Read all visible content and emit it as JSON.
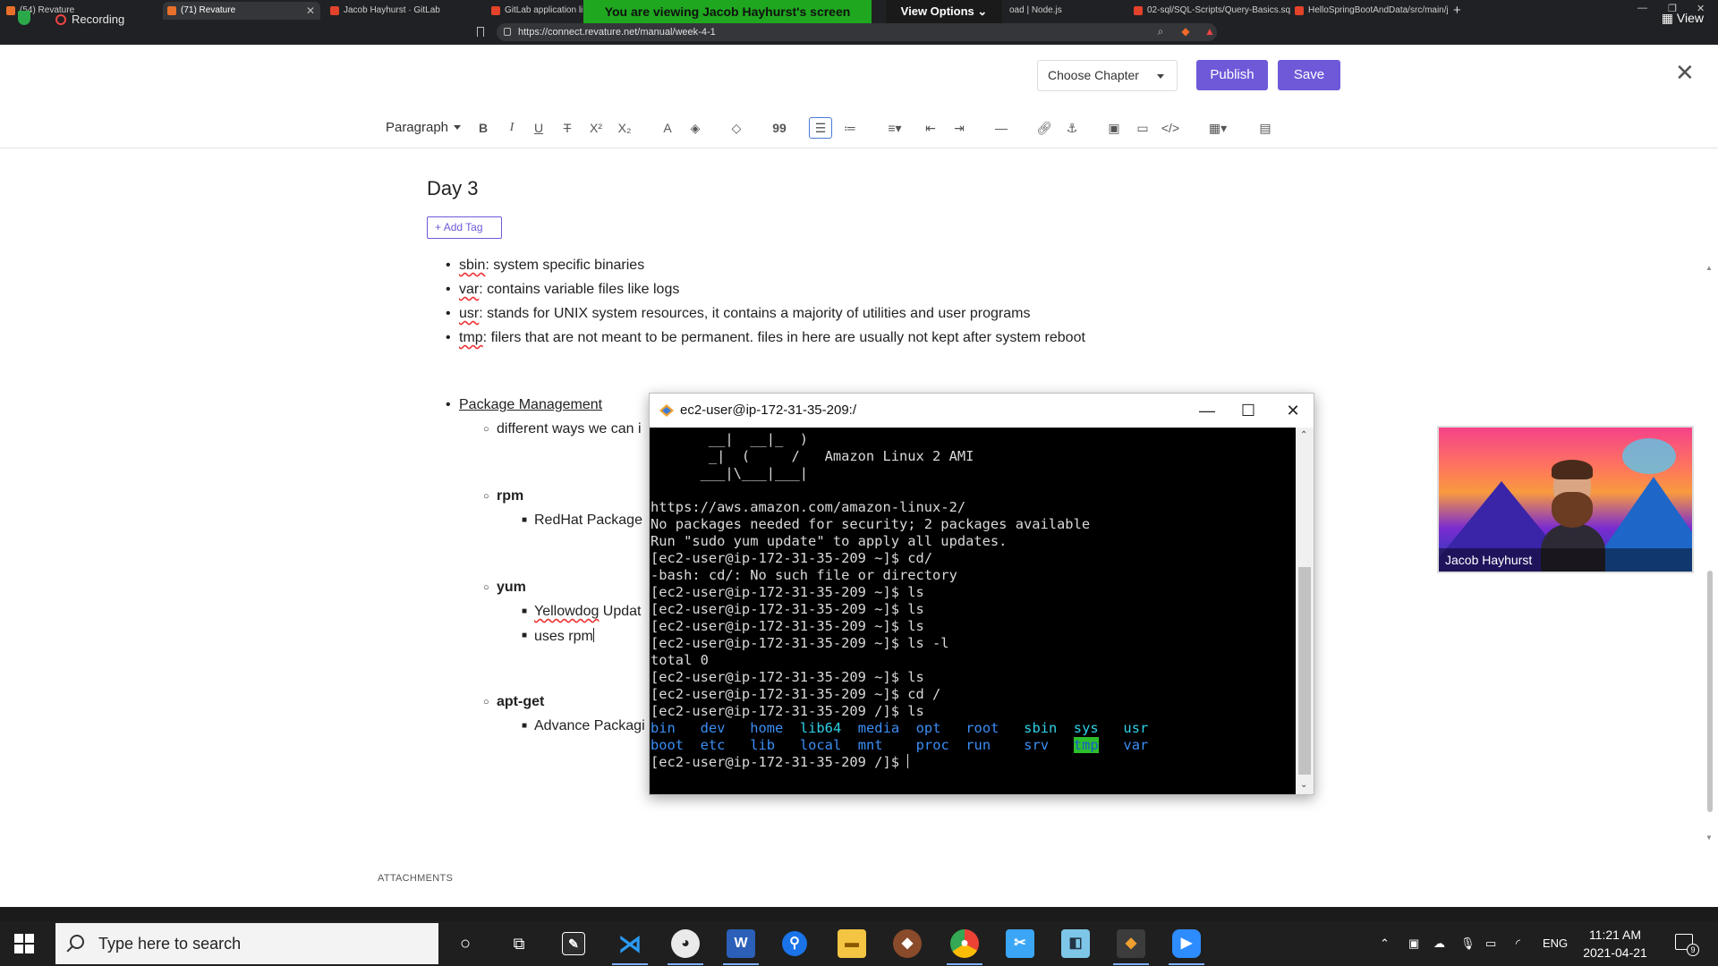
{
  "browser": {
    "tabs": [
      {
        "label": "(54) Revature",
        "fav": "#e8702a"
      },
      {
        "label": "(71) Revature",
        "fav": "#e8702a"
      },
      {
        "label": "Jacob Hayhurst · GitLab",
        "fav": "#e2432a"
      },
      {
        "label": "GitLab application lim",
        "fav": "#e2432a"
      },
      {
        "label": "oad | Node.js",
        "fav": "#5fa04e"
      },
      {
        "label": "02-sql/SQL-Scripts/Query-Basics.sql ·",
        "fav": "#e2432a"
      },
      {
        "label": "HelloSpringBootAndData/src/main/ja",
        "fav": "#e2432a"
      }
    ],
    "recording_label": "Recording",
    "url": "https://connect.revature.net/manual/week-4-1",
    "plus": "+"
  },
  "zoom": {
    "banner": "You are viewing Jacob Hayhurst's screen",
    "view_options": "View Options",
    "view_label": "View"
  },
  "editor": {
    "choose_chapter": "Choose Chapter",
    "publish": "Publish",
    "save": "Save",
    "paragraph": "Paragraph"
  },
  "doc": {
    "title": "Day 3",
    "add_tag": "Add Tag",
    "bullets": [
      {
        "term": "sbin",
        "text": ": system specific binaries"
      },
      {
        "term": "var",
        "text": ": contains variable files like logs"
      },
      {
        "term": "usr",
        "text": ": stands for UNIX system resources, it contains a majority of utilities and user programs"
      },
      {
        "term": "tmp",
        "text": ": filers that are not meant to be permanent. files in here are usually not kept after system reboot"
      }
    ],
    "pkg_heading": "Package Management",
    "pkg_sub": "different ways we can i",
    "rpm": "rpm",
    "rpm_desc": "RedHat Package",
    "yum": "yum",
    "yum_desc_term": "Yellowdog",
    "yum_desc_rest": " Updat",
    "yum_uses": "uses rpm",
    "apt": "apt-get",
    "apt_desc": "Advance Packagi",
    "attachments": "ATTACHMENTS"
  },
  "terminal": {
    "title": "ec2-user@ip-172-31-35-209:/",
    "banner_lines": [
      "       __|  __|_  )",
      "       _|  (     /   Amazon Linux 2 AMI",
      "      ___|\\___|___|"
    ],
    "lines": [
      "https://aws.amazon.com/amazon-linux-2/",
      "No packages needed for security; 2 packages available",
      "Run \"sudo yum update\" to apply all updates.",
      "[ec2-user@ip-172-31-35-209 ~]$ cd/",
      "-bash: cd/: No such file or directory",
      "[ec2-user@ip-172-31-35-209 ~]$ ls",
      "[ec2-user@ip-172-31-35-209 ~]$ ls",
      "[ec2-user@ip-172-31-35-209 ~]$ ls",
      "[ec2-user@ip-172-31-35-209 ~]$ ls -l",
      "total 0",
      "[ec2-user@ip-172-31-35-209 ~]$ ls",
      "[ec2-user@ip-172-31-35-209 ~]$ cd /",
      "[ec2-user@ip-172-31-35-209 /]$ ls"
    ],
    "ls_row1": [
      "bin",
      "dev",
      "home",
      "lib64",
      "media",
      "opt",
      "root",
      "sbin",
      "sys",
      "usr"
    ],
    "ls_row2": [
      "boot",
      "etc",
      "lib",
      "local",
      "mnt",
      "proc",
      "run",
      "srv",
      "tmp",
      "var"
    ],
    "prompt": "[ec2-user@ip-172-31-35-209 /]$ "
  },
  "video": {
    "participant": "Jacob Hayhurst"
  },
  "taskbar": {
    "search_placeholder": "Type here to search",
    "lang": "ENG",
    "time": "11:21 AM",
    "date": "2021-04-21",
    "notif_count": "9"
  }
}
